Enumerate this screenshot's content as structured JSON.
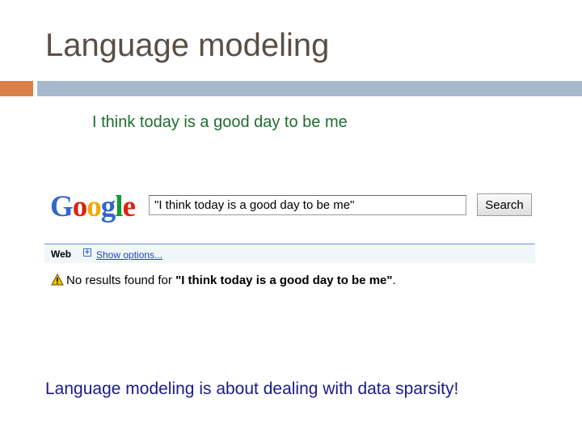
{
  "slide": {
    "title": "Language modeling",
    "sentence": "I think today is a good day to be me",
    "conclusion": "Language modeling is about dealing with data sparsity!"
  },
  "google": {
    "logo_letters": [
      "G",
      "o",
      "o",
      "g",
      "l",
      "e"
    ],
    "logo_colors": [
      "#3366cc",
      "#dd2211",
      "#eeaa00",
      "#3366cc",
      "#119933",
      "#dd2211"
    ],
    "search_value": "\"I think today is a good day to be me\"",
    "search_button": "Search",
    "results_bar": {
      "web_label": "Web",
      "show_options": "Show options..."
    },
    "no_results_prefix": "No results found for ",
    "no_results_query": "\"I think today is a good day to be me\"",
    "no_results_suffix": ".",
    "warning_icon": "warning-triangle-icon"
  },
  "colors": {
    "accent_orange": "#d9804a",
    "accent_blue": "#a5b8cc",
    "sentence_green": "#1f6e2e",
    "conclusion_blue": "#1a1a8a"
  }
}
